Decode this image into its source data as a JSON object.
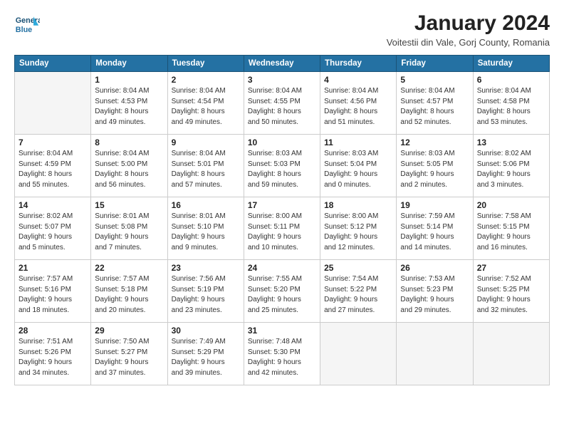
{
  "logo": {
    "line1": "General",
    "line2": "Blue"
  },
  "title": "January 2024",
  "location": "Voitestii din Vale, Gorj County, Romania",
  "weekdays": [
    "Sunday",
    "Monday",
    "Tuesday",
    "Wednesday",
    "Thursday",
    "Friday",
    "Saturday"
  ],
  "weeks": [
    [
      {
        "day": "",
        "info": ""
      },
      {
        "day": "1",
        "info": "Sunrise: 8:04 AM\nSunset: 4:53 PM\nDaylight: 8 hours\nand 49 minutes."
      },
      {
        "day": "2",
        "info": "Sunrise: 8:04 AM\nSunset: 4:54 PM\nDaylight: 8 hours\nand 49 minutes."
      },
      {
        "day": "3",
        "info": "Sunrise: 8:04 AM\nSunset: 4:55 PM\nDaylight: 8 hours\nand 50 minutes."
      },
      {
        "day": "4",
        "info": "Sunrise: 8:04 AM\nSunset: 4:56 PM\nDaylight: 8 hours\nand 51 minutes."
      },
      {
        "day": "5",
        "info": "Sunrise: 8:04 AM\nSunset: 4:57 PM\nDaylight: 8 hours\nand 52 minutes."
      },
      {
        "day": "6",
        "info": "Sunrise: 8:04 AM\nSunset: 4:58 PM\nDaylight: 8 hours\nand 53 minutes."
      }
    ],
    [
      {
        "day": "7",
        "info": "Sunrise: 8:04 AM\nSunset: 4:59 PM\nDaylight: 8 hours\nand 55 minutes."
      },
      {
        "day": "8",
        "info": "Sunrise: 8:04 AM\nSunset: 5:00 PM\nDaylight: 8 hours\nand 56 minutes."
      },
      {
        "day": "9",
        "info": "Sunrise: 8:04 AM\nSunset: 5:01 PM\nDaylight: 8 hours\nand 57 minutes."
      },
      {
        "day": "10",
        "info": "Sunrise: 8:03 AM\nSunset: 5:03 PM\nDaylight: 8 hours\nand 59 minutes."
      },
      {
        "day": "11",
        "info": "Sunrise: 8:03 AM\nSunset: 5:04 PM\nDaylight: 9 hours\nand 0 minutes."
      },
      {
        "day": "12",
        "info": "Sunrise: 8:03 AM\nSunset: 5:05 PM\nDaylight: 9 hours\nand 2 minutes."
      },
      {
        "day": "13",
        "info": "Sunrise: 8:02 AM\nSunset: 5:06 PM\nDaylight: 9 hours\nand 3 minutes."
      }
    ],
    [
      {
        "day": "14",
        "info": "Sunrise: 8:02 AM\nSunset: 5:07 PM\nDaylight: 9 hours\nand 5 minutes."
      },
      {
        "day": "15",
        "info": "Sunrise: 8:01 AM\nSunset: 5:08 PM\nDaylight: 9 hours\nand 7 minutes."
      },
      {
        "day": "16",
        "info": "Sunrise: 8:01 AM\nSunset: 5:10 PM\nDaylight: 9 hours\nand 9 minutes."
      },
      {
        "day": "17",
        "info": "Sunrise: 8:00 AM\nSunset: 5:11 PM\nDaylight: 9 hours\nand 10 minutes."
      },
      {
        "day": "18",
        "info": "Sunrise: 8:00 AM\nSunset: 5:12 PM\nDaylight: 9 hours\nand 12 minutes."
      },
      {
        "day": "19",
        "info": "Sunrise: 7:59 AM\nSunset: 5:14 PM\nDaylight: 9 hours\nand 14 minutes."
      },
      {
        "day": "20",
        "info": "Sunrise: 7:58 AM\nSunset: 5:15 PM\nDaylight: 9 hours\nand 16 minutes."
      }
    ],
    [
      {
        "day": "21",
        "info": "Sunrise: 7:57 AM\nSunset: 5:16 PM\nDaylight: 9 hours\nand 18 minutes."
      },
      {
        "day": "22",
        "info": "Sunrise: 7:57 AM\nSunset: 5:18 PM\nDaylight: 9 hours\nand 20 minutes."
      },
      {
        "day": "23",
        "info": "Sunrise: 7:56 AM\nSunset: 5:19 PM\nDaylight: 9 hours\nand 23 minutes."
      },
      {
        "day": "24",
        "info": "Sunrise: 7:55 AM\nSunset: 5:20 PM\nDaylight: 9 hours\nand 25 minutes."
      },
      {
        "day": "25",
        "info": "Sunrise: 7:54 AM\nSunset: 5:22 PM\nDaylight: 9 hours\nand 27 minutes."
      },
      {
        "day": "26",
        "info": "Sunrise: 7:53 AM\nSunset: 5:23 PM\nDaylight: 9 hours\nand 29 minutes."
      },
      {
        "day": "27",
        "info": "Sunrise: 7:52 AM\nSunset: 5:25 PM\nDaylight: 9 hours\nand 32 minutes."
      }
    ],
    [
      {
        "day": "28",
        "info": "Sunrise: 7:51 AM\nSunset: 5:26 PM\nDaylight: 9 hours\nand 34 minutes."
      },
      {
        "day": "29",
        "info": "Sunrise: 7:50 AM\nSunset: 5:27 PM\nDaylight: 9 hours\nand 37 minutes."
      },
      {
        "day": "30",
        "info": "Sunrise: 7:49 AM\nSunset: 5:29 PM\nDaylight: 9 hours\nand 39 minutes."
      },
      {
        "day": "31",
        "info": "Sunrise: 7:48 AM\nSunset: 5:30 PM\nDaylight: 9 hours\nand 42 minutes."
      },
      {
        "day": "",
        "info": ""
      },
      {
        "day": "",
        "info": ""
      },
      {
        "day": "",
        "info": ""
      }
    ]
  ]
}
